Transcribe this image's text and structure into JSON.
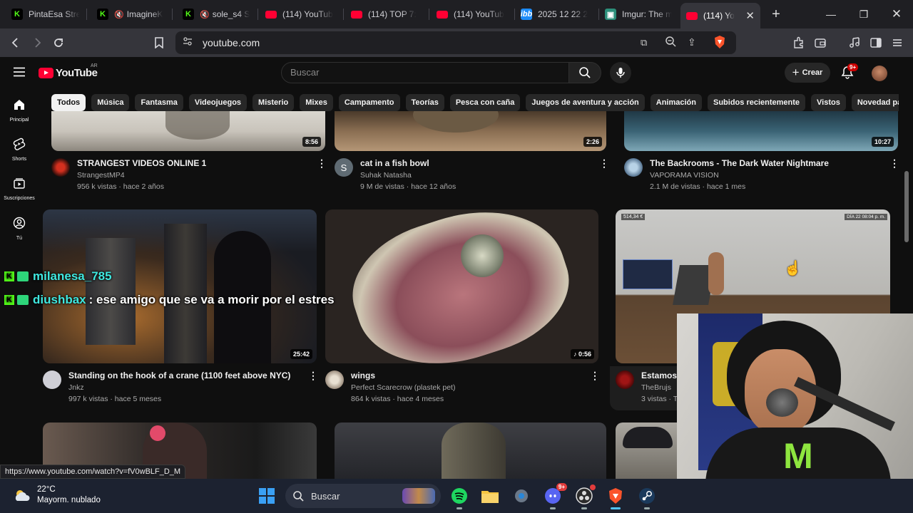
{
  "browser": {
    "tabs": [
      {
        "title": "PintaEsa Stre",
        "favicon": "kick-icon"
      },
      {
        "title": "ImagineK",
        "favicon": "kick-icon",
        "muted": true
      },
      {
        "title": "sole_s4 S",
        "favicon": "kick-icon",
        "muted": true
      },
      {
        "title": "(114) YouTub",
        "favicon": "youtube-icon"
      },
      {
        "title": "(114) TOP 7:",
        "favicon": "youtube-icon"
      },
      {
        "title": "(114) YouTub",
        "favicon": "youtube-icon"
      },
      {
        "title": "2025 12 22 2",
        "favicon": "ibb-icon"
      },
      {
        "title": "Imgur: The m",
        "favicon": "imgur-icon"
      },
      {
        "title": "(114) Yo",
        "favicon": "youtube-icon",
        "active": true
      }
    ],
    "url": "youtube.com",
    "status_url": "https://www.youtube.com/watch?v=fV0wBLF_D_M"
  },
  "youtube": {
    "logo_text": "YouTube",
    "country": "AR",
    "search_placeholder": "Buscar",
    "create_label": "Crear",
    "notifications": "9+",
    "chips": [
      "Todos",
      "Música",
      "Fantasma",
      "Videojuegos",
      "Misterio",
      "Mixes",
      "Campamento",
      "Teorías",
      "Pesca con caña",
      "Juegos de aventura y acción",
      "Animación",
      "Subidos recientemente",
      "Vistos",
      "Novedad para ti"
    ],
    "sidebar": [
      {
        "label": "Principal",
        "icon": "home-icon"
      },
      {
        "label": "Shorts",
        "icon": "shorts-icon"
      },
      {
        "label": "Suscripciones",
        "icon": "subscriptions-icon"
      },
      {
        "label": "Tú",
        "icon": "you-icon"
      }
    ],
    "videos": [
      {
        "title": "STRANGEST VIDEOS ONLINE 1",
        "channel": "StrangestMP4",
        "meta": "956 k vistas · hace 2 años",
        "duration": "8:56"
      },
      {
        "title": "cat in a fish bowl",
        "channel": "Suhak Natasha",
        "meta": "9 M de vistas · hace 12 años",
        "duration": "2:26",
        "avatar_letter": "S"
      },
      {
        "title": "The Backrooms - The Dark Water Nightmare",
        "channel": "VAPORAMA VISION",
        "meta": "2.1 M de vistas · hace 1 mes",
        "duration": "10:27"
      },
      {
        "title": "Standing on the hook of a crane (1100 feet above NYC)",
        "channel": "Jnkz",
        "meta": "997 k vistas · hace 5 meses",
        "duration": "25:42"
      },
      {
        "title": "wings",
        "channel": "Perfect Scarecrow (plastek pet)",
        "meta": "864 k vistas · hace 4 meses",
        "duration": "0:56"
      },
      {
        "title": "Estamos",
        "channel": "TheBrujs",
        "meta": "3 vistas · T"
      }
    ]
  },
  "chat": [
    {
      "user": "milanesa_785",
      "message": ""
    },
    {
      "user": "diushbax",
      "message": ": ese amigo que se va a morir por el estres"
    }
  ],
  "stream_overlay": {
    "money": "514,34 €",
    "day": "DÍA 22  08:04 p. m."
  },
  "taskbar": {
    "temperature": "22°C",
    "weather": "Mayorm. nublado",
    "search_label": "Buscar",
    "discord_badge": "9+"
  }
}
